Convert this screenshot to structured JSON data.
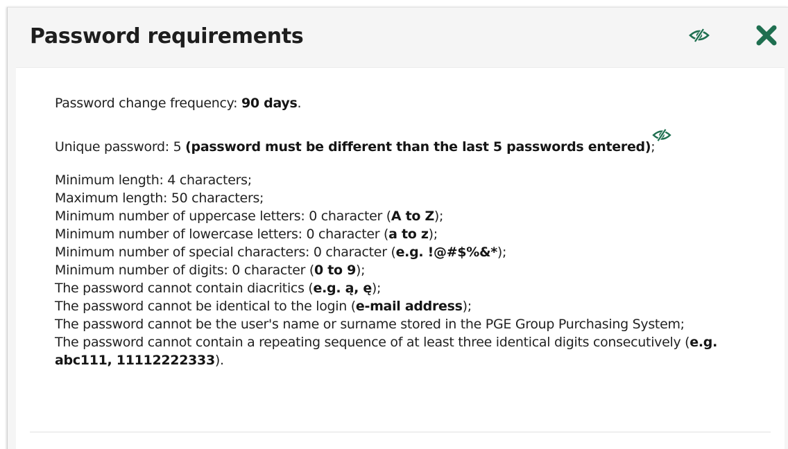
{
  "dialog": {
    "title": "Password requirements",
    "header_eye_icon": "eye-slash-icon",
    "close_icon": "close-x-icon",
    "accent_color": "#1f6f50"
  },
  "requirements": {
    "frequency": {
      "label": "Password change frequency: ",
      "value": "90 days",
      "suffix": "."
    },
    "unique": {
      "label": "Unique password: 5 ",
      "value": "(password must be different than the last 5 passwords entered)",
      "suffix": ";",
      "icon": "eye-slash-icon"
    },
    "min_length": "Minimum length: 4 characters;",
    "max_length": "Maximum length: 50 characters;",
    "uppercase": {
      "label": "Minimum number of uppercase letters: 0 character (",
      "value": "A to Z",
      "suffix": ");"
    },
    "lowercase": {
      "label": "Minimum number of lowercase letters: 0 character (",
      "value": "a to z",
      "suffix": ");"
    },
    "special": {
      "label": "Minimum number of special characters: 0 character (",
      "value": "e.g. !@#$%&*",
      "suffix": ");"
    },
    "digits": {
      "label": "Minimum number of digits: 0 character (",
      "value": "0 to 9",
      "suffix": ");"
    },
    "diacritics": {
      "label": "The password cannot contain diacritics (",
      "value": "e.g. ą, ę",
      "suffix": ");"
    },
    "login": {
      "label": "The password cannot be identical to the login (",
      "value": "e-mail address",
      "suffix": ");"
    },
    "name": "The password cannot be the user's name or surname stored in the PGE Group Purchasing System;",
    "repeat": {
      "label": "The password cannot contain a repeating sequence of at least three identical digits consecutively (",
      "value": "e.g. abc111, 11112222333",
      "suffix": ")."
    }
  }
}
